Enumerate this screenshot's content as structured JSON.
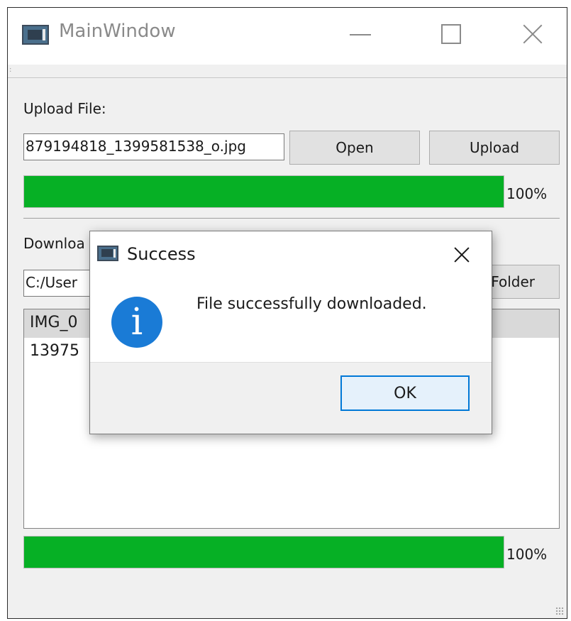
{
  "window": {
    "title": "MainWindow",
    "icon": "app-window-icon",
    "controls": [
      "minimize-icon",
      "maximize-icon",
      "close-icon"
    ]
  },
  "upload": {
    "label": "Upload File:",
    "file_path": "879194818_1399581538_o.jpg",
    "open_label": "Open",
    "upload_label": "Upload",
    "progress_value": 100,
    "progress_text": "100%"
  },
  "download": {
    "label": "Downloa",
    "folder_path": "C:/User",
    "folder_button_label": "Folder",
    "files": [
      "IMG_0",
      "13975"
    ],
    "selected_index": 0,
    "progress_value": 100,
    "progress_text": "100%"
  },
  "dialog": {
    "title": "Success",
    "icon": "info-icon",
    "icon_glyph": "i",
    "message": "File successfully downloaded.",
    "ok_label": "OK"
  },
  "colors": {
    "progress_fill": "#06b025",
    "info_icon": "#1a7bd6",
    "ok_button_border": "#0078d7",
    "list_selection": "#d9d9d9"
  }
}
